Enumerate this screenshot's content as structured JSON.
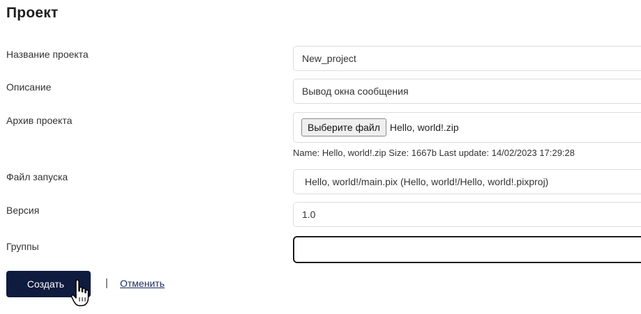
{
  "page": {
    "title": "Проект"
  },
  "form": {
    "name_label": "Название проекта",
    "name_value": "New_project",
    "description_label": "Описание",
    "description_value": "Вывод окна сообщения",
    "archive_label": "Архив проекта",
    "archive_button": "Выберите файл",
    "archive_filename": "Hello, world!.zip",
    "archive_info": "Name: Hello, world!.zip Size: 1667b Last update: 14/02/2023 17:29:28",
    "launch_label": "Файл запуска",
    "launch_value": "Hello, world!/main.pix (Hello, world!/Hello, world!.pixproj)",
    "version_label": "Версия",
    "version_value": "1.0",
    "groups_label": "Группы",
    "groups_value": ""
  },
  "actions": {
    "create_label": "Создать",
    "separator": "|",
    "cancel_label": "Отменить"
  },
  "colors": {
    "primary_button": "#0f1b3f",
    "link": "#1b2a5c"
  },
  "icons": {
    "cursor": "hand-pointer-cursor-icon"
  }
}
